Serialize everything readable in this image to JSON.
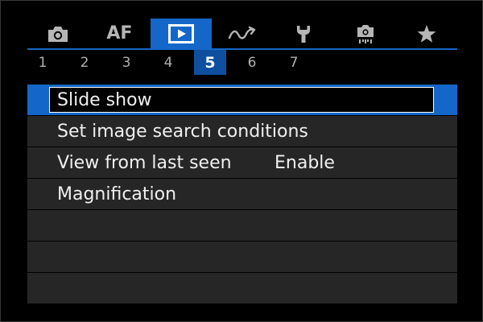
{
  "tabs": [
    {
      "icon": "camera-icon",
      "active": false
    },
    {
      "label": "AF",
      "active": false
    },
    {
      "icon": "playback-icon",
      "active": true
    },
    {
      "icon": "wireless-icon",
      "active": false
    },
    {
      "icon": "wrench-icon",
      "active": false
    },
    {
      "icon": "custom-functions-icon",
      "active": false
    },
    {
      "icon": "star-icon",
      "active": false
    }
  ],
  "pages": [
    "1",
    "2",
    "3",
    "4",
    "5",
    "6",
    "7"
  ],
  "active_page": "5",
  "menu": {
    "items": [
      {
        "label": "Slide show",
        "value": "",
        "selected": true
      },
      {
        "label": "Set image search conditions",
        "value": ""
      },
      {
        "label": "View from last seen",
        "value": "Enable"
      },
      {
        "label": "Magnification",
        "value": ""
      },
      {
        "label": "",
        "value": ""
      },
      {
        "label": "",
        "value": ""
      },
      {
        "label": "",
        "value": ""
      }
    ]
  },
  "colors": {
    "accent": "#1467c8",
    "row_bg": "#262626",
    "text": "#f0f0f0"
  }
}
